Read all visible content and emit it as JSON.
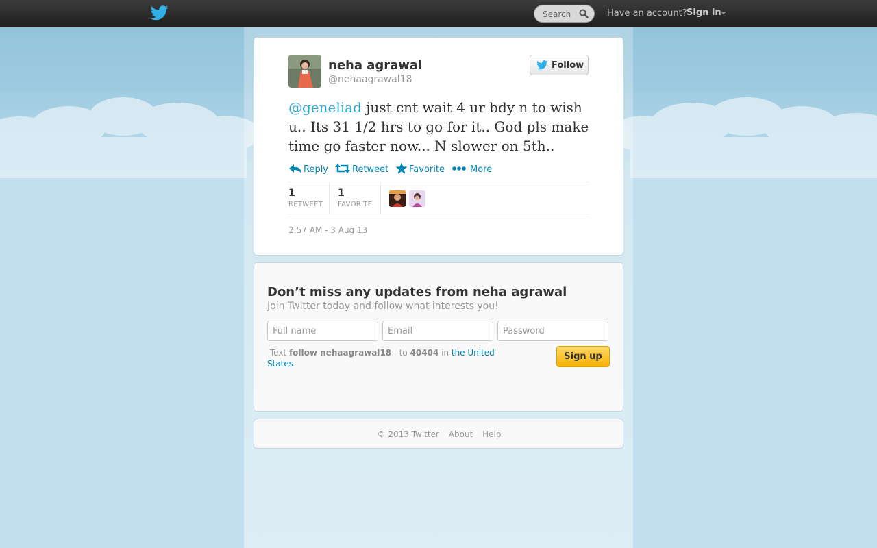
{
  "topbar": {
    "search_placeholder": "Search",
    "have_account": "Have an account?",
    "sign_in": "Sign in"
  },
  "tweet": {
    "full_name": "neha agrawal",
    "screen_name": "@nehaagrawal18",
    "follow_label": "Follow",
    "mention": "@geneliad",
    "text": " just cnt wait 4 ur bdy n to wish u.. Its 31 1/2 hrs to go for it.. God pls make time go faster now... N slower on 5th..",
    "actions": {
      "reply": "Reply",
      "retweet": "Retweet",
      "favorite": "Favorite",
      "more": "More"
    },
    "stats": {
      "retweet_count": "1",
      "retweet_label": "RETWEET",
      "favorite_count": "1",
      "favorite_label": "FAVORITE"
    },
    "timestamp": "2:57 AM - 3 Aug 13"
  },
  "signup": {
    "title": "Don’t miss any updates from neha agrawal",
    "subtitle": "Join Twitter today and follow what interests you!",
    "full_name_placeholder": "Full name",
    "email_placeholder": "Email",
    "password_placeholder": "Password",
    "sms_text": "Text",
    "sms_command": "follow nehaagrawal18",
    "sms_to": "to",
    "sms_number": "40404",
    "sms_in": "in",
    "sms_country": "the United States",
    "button": "Sign up"
  },
  "footer": {
    "copyright": "© 2013 Twitter",
    "about": "About",
    "help": "Help"
  },
  "colors": {
    "link": "#0084b4",
    "mention": "#2fa8d4",
    "topbar": "#2a2a2a",
    "background": "#c0deed",
    "signup_button": "#f7b202"
  }
}
